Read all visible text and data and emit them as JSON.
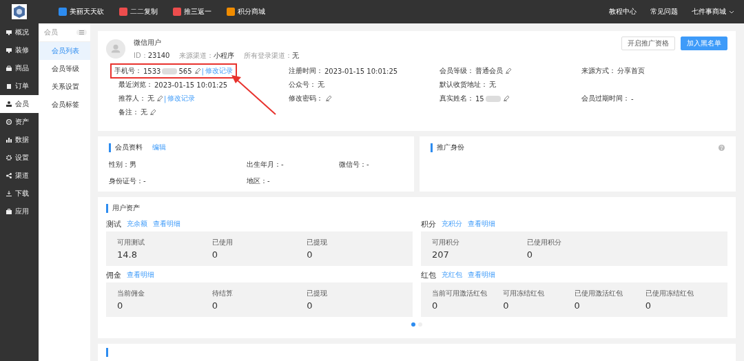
{
  "topbar": {
    "apps": [
      {
        "label": "美丽天天砍",
        "color": "#2d8cf0"
      },
      {
        "label": "二二复制",
        "color": "#ed4d4d"
      },
      {
        "label": "推三返一",
        "color": "#ed4d4d"
      },
      {
        "label": "积分商城",
        "color": "#f08c00"
      }
    ],
    "links": [
      "教程中心",
      "常见问题"
    ],
    "store": "七件事商城"
  },
  "sidebar": {
    "items": [
      {
        "label": "概况",
        "selected": false
      },
      {
        "label": "装修",
        "selected": false
      },
      {
        "label": "商品",
        "selected": false
      },
      {
        "label": "订单",
        "selected": false
      },
      {
        "label": "会员",
        "selected": true
      },
      {
        "label": "资产",
        "selected": false
      },
      {
        "label": "数据",
        "selected": false
      },
      {
        "label": "设置",
        "selected": false
      },
      {
        "label": "渠道",
        "selected": false
      },
      {
        "label": "下载",
        "selected": false
      },
      {
        "label": "应用",
        "selected": false
      }
    ]
  },
  "subnav": {
    "title": "会员",
    "items": [
      {
        "label": "会员列表",
        "selected": true
      },
      {
        "label": "会员等级",
        "selected": false
      },
      {
        "label": "关系设置",
        "selected": false
      },
      {
        "label": "会员标签",
        "selected": false
      }
    ]
  },
  "profile": {
    "name": "微信用户",
    "meta": [
      {
        "label": "ID：",
        "value": "23140"
      },
      {
        "label": "来源渠道：",
        "value": "小程序"
      },
      {
        "label": "所有登录渠道：",
        "value": "无"
      }
    ],
    "buttons": [
      {
        "label": "开启推广资格",
        "primary": false
      },
      {
        "label": "加入黑名单",
        "primary": true
      }
    ],
    "rows": [
      [
        {
          "label": "手机号：",
          "value": "1533",
          "masked": true,
          "value_after_mask": "565",
          "editable": true,
          "separator": "|",
          "link": "修改记录",
          "highlighted": true
        },
        {
          "label": "注册时间：",
          "value": "2023-01-15 10:01:25"
        },
        {
          "label": "会员等级：",
          "value": "普通会员",
          "editable": true
        },
        {
          "label": "来源方式：",
          "value": "分享首页"
        }
      ],
      [
        {
          "label": "最近浏览：",
          "value": "2023-01-15 10:01:25"
        },
        {
          "label": "公众号：",
          "value": "无"
        },
        {
          "label": "默认收货地址：",
          "value": "无"
        }
      ],
      [
        {
          "label": "推荐人：",
          "value": "无",
          "editable": true,
          "separator": "|",
          "link": "修改记录"
        },
        {
          "label": "修改密码：",
          "editable": true
        },
        {
          "label": "真实姓名：",
          "value": "15",
          "masked": true,
          "editable": true
        },
        {
          "label": "会员过期时间：",
          "value": "-"
        }
      ],
      [
        {
          "label": "备注：",
          "value": "无",
          "editable": true
        }
      ]
    ]
  },
  "member_info": {
    "title": "会员资料",
    "action": "编辑",
    "fields": [
      {
        "label": "性别：",
        "value": "男"
      },
      {
        "label": "出生年月：",
        "value": "-"
      },
      {
        "label": "微信号：",
        "value": "-"
      },
      {
        "label": "身份证号：",
        "value": "-"
      },
      {
        "label": "地区：",
        "value": "-"
      }
    ]
  },
  "promotion": {
    "title": "推广身份"
  },
  "assets": {
    "title": "用户资产",
    "groups": [
      {
        "title": "测试",
        "action": "充余额",
        "detail": "查看明细",
        "stats": [
          {
            "label": "可用测试",
            "value": "14.8"
          },
          {
            "label": "已使用",
            "value": "0"
          },
          {
            "label": "已提现",
            "value": "0"
          }
        ]
      },
      {
        "title": "积分",
        "action": "充积分",
        "detail": "查看明细",
        "stats": [
          {
            "label": "可用积分",
            "value": "207"
          },
          {
            "label": "已使用积分",
            "value": "0"
          }
        ]
      },
      {
        "title": "佣金",
        "detail": "查看明细",
        "stats": [
          {
            "label": "当前佣金",
            "value": "0"
          },
          {
            "label": "待结算",
            "value": "0"
          },
          {
            "label": "已提现",
            "value": "0"
          }
        ]
      },
      {
        "title": "红包",
        "action": "充红包",
        "detail": "查看明细",
        "stats": [
          {
            "label": "当前可用激活红包",
            "value": "0"
          },
          {
            "label": "可用冻结红包",
            "value": "0"
          },
          {
            "label": "已使用激活红包",
            "value": "0"
          },
          {
            "label": "已使用冻结红包",
            "value": "0"
          }
        ]
      }
    ],
    "pages": [
      {
        "selected": true
      },
      {
        "selected": false
      }
    ]
  }
}
